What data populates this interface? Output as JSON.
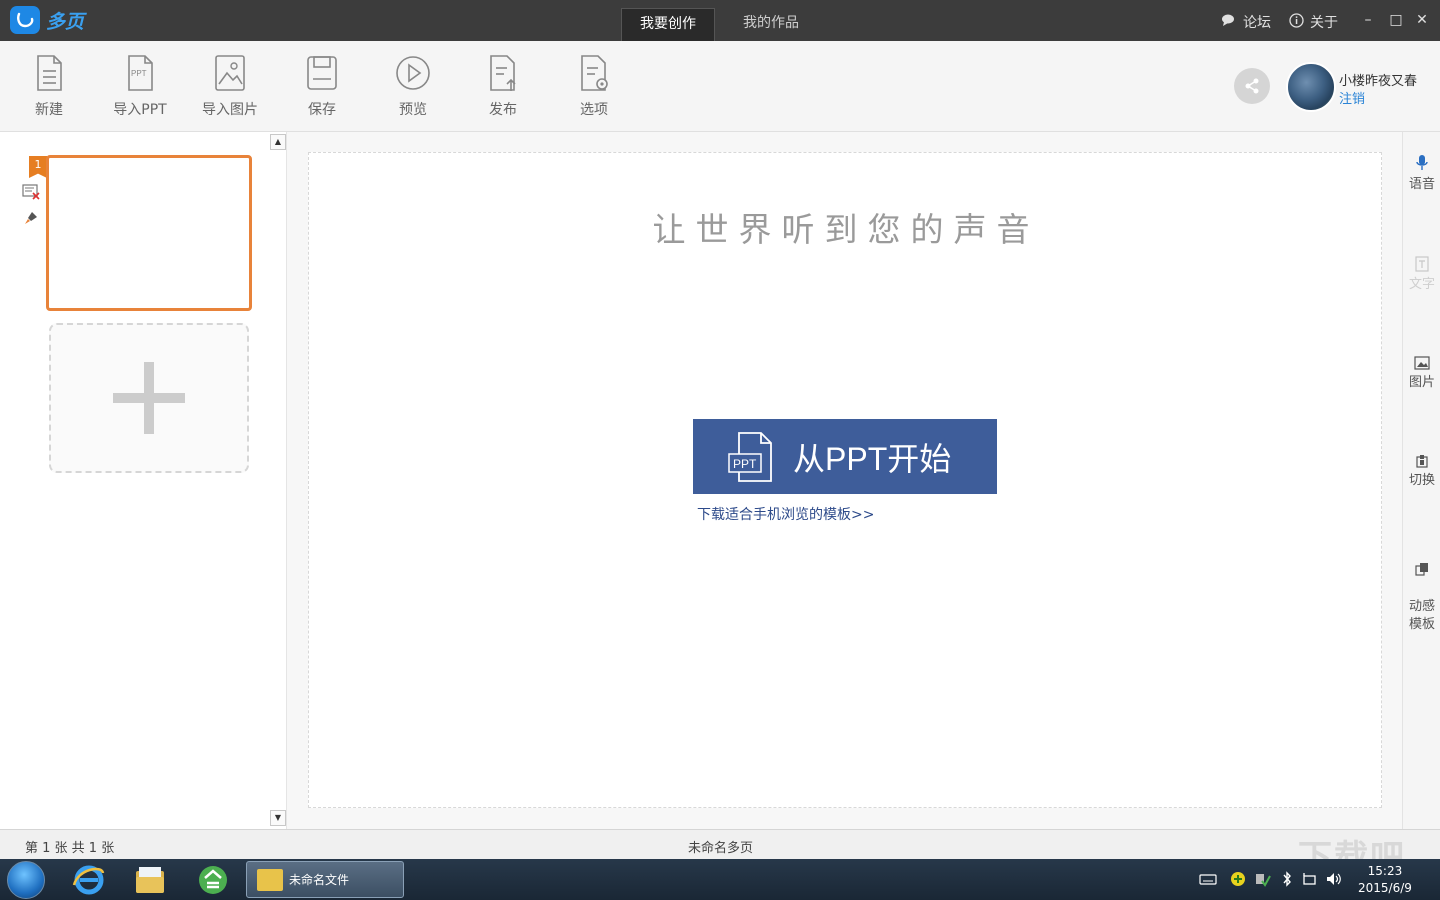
{
  "app": {
    "name": "多页"
  },
  "tabs": [
    {
      "label": "我要创作",
      "active": true
    },
    {
      "label": "我的作品",
      "active": false
    }
  ],
  "title_links": {
    "forum": "论坛",
    "about": "关于"
  },
  "window_controls": {
    "minimize": "–",
    "maximize": "□",
    "close": "✕"
  },
  "toolbar": {
    "items": [
      {
        "label": "新建",
        "icon": "new-file-icon"
      },
      {
        "label": "导入PPT",
        "icon": "import-ppt-icon"
      },
      {
        "label": "导入图片",
        "icon": "import-image-icon"
      },
      {
        "label": "保存",
        "icon": "save-icon"
      },
      {
        "label": "预览",
        "icon": "preview-play-icon"
      },
      {
        "label": "发布",
        "icon": "publish-icon"
      },
      {
        "label": "选项",
        "icon": "options-icon"
      }
    ],
    "ppt_icon_text": "PPT"
  },
  "user": {
    "name": "小楼昨夜又春",
    "logout": "注销"
  },
  "slides": {
    "current_number": "1"
  },
  "canvas": {
    "slogan": "让世界听到您的声音",
    "start_button": "从PPT开始",
    "start_button_icon_text": "PPT",
    "template_link": "下载适合手机浏览的模板>>"
  },
  "right_sidebar": {
    "items": [
      {
        "label": "语音",
        "enabled": true,
        "icon": "microphone-icon"
      },
      {
        "label": "文字",
        "enabled": false,
        "icon": "text-icon"
      },
      {
        "label": "图片",
        "enabled": true,
        "icon": "image-icon"
      },
      {
        "label": "切换",
        "enabled": true,
        "icon": "transition-icon"
      },
      {
        "label": "动感\n模板",
        "enabled": true,
        "icon": "dynamic-template-icon"
      }
    ]
  },
  "status": {
    "page_info": "第 1 张  共 1 张",
    "doc_name": "未命名多页"
  },
  "taskbar": {
    "task_label": "未命名文件",
    "time": "15:23",
    "date": "2015/6/9"
  },
  "colors": {
    "accent_orange": "#e8833a",
    "button_blue": "#3e5d9a",
    "link_blue": "#2b84d6",
    "titlebar": "#3c3c3c"
  }
}
